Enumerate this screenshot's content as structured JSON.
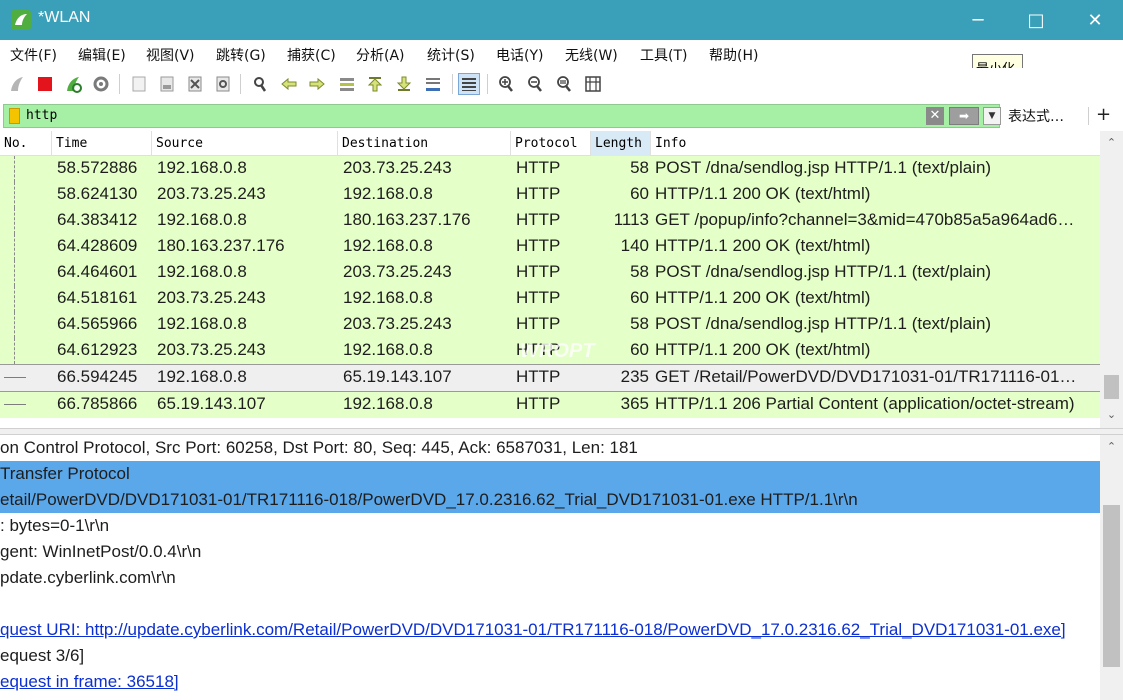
{
  "window": {
    "title": "*WLAN",
    "minimize_glyph": "─",
    "maximize_glyph": "□",
    "close_glyph": "✕",
    "tooltip": "最小化"
  },
  "menu": [
    "文件(F)",
    "编辑(E)",
    "视图(V)",
    "跳转(G)",
    "捕获(C)",
    "分析(A)",
    "统计(S)",
    "电话(Y)",
    "无线(W)",
    "工具(T)",
    "帮助(H)"
  ],
  "toolbar": {
    "icons": [
      "start-capture-icon",
      "stop-capture-icon",
      "restart-capture-icon",
      "capture-options-icon",
      "open-file-icon",
      "save-file-icon",
      "close-file-icon",
      "reload-file-icon",
      "find-packet-icon",
      "go-back-icon",
      "go-forward-icon",
      "go-to-packet-icon",
      "first-packet-icon",
      "last-packet-icon",
      "auto-scroll-icon",
      "colorize-icon",
      "zoom-in-icon",
      "zoom-out-icon",
      "normal-size-icon",
      "resize-columns-icon"
    ]
  },
  "filter": {
    "value": "http",
    "clear_glyph": "✕",
    "apply_glyph": "➡",
    "dropdown_glyph": "▼",
    "expression_label": "表达式…",
    "add_glyph": "+"
  },
  "packet_list": {
    "columns": [
      "No.",
      "Time",
      "Source",
      "Destination",
      "Protocol",
      "Length",
      "Info"
    ],
    "sorted_column": "Length",
    "rows": [
      {
        "time": "58.572886",
        "src": "192.168.0.8",
        "dst": "203.73.25.243",
        "proto": "HTTP",
        "len": "58",
        "info": "POST /dna/sendlog.jsp HTTP/1.1  (text/plain)"
      },
      {
        "time": "58.624130",
        "src": "203.73.25.243",
        "dst": "192.168.0.8",
        "proto": "HTTP",
        "len": "60",
        "info": "HTTP/1.1 200 OK  (text/html)"
      },
      {
        "time": "64.383412",
        "src": "192.168.0.8",
        "dst": "180.163.237.176",
        "proto": "HTTP",
        "len": "1113",
        "info": "GET /popup/info?channel=3&mid=470b85a5a964ad6…"
      },
      {
        "time": "64.428609",
        "src": "180.163.237.176",
        "dst": "192.168.0.8",
        "proto": "HTTP",
        "len": "140",
        "info": "HTTP/1.1 200 OK  (text/html)"
      },
      {
        "time": "64.464601",
        "src": "192.168.0.8",
        "dst": "203.73.25.243",
        "proto": "HTTP",
        "len": "58",
        "info": "POST /dna/sendlog.jsp HTTP/1.1  (text/plain)"
      },
      {
        "time": "64.518161",
        "src": "203.73.25.243",
        "dst": "192.168.0.8",
        "proto": "HTTP",
        "len": "60",
        "info": "HTTP/1.1 200 OK  (text/html)"
      },
      {
        "time": "64.565966",
        "src": "192.168.0.8",
        "dst": "203.73.25.243",
        "proto": "HTTP",
        "len": "58",
        "info": "POST /dna/sendlog.jsp HTTP/1.1  (text/plain)"
      },
      {
        "time": "64.612923",
        "src": "203.73.25.243",
        "dst": "192.168.0.8",
        "proto": "HTTP",
        "len": "60",
        "info": "HTTP/1.1 200 OK  (text/html)"
      },
      {
        "time": "66.594245",
        "src": "192.168.0.8",
        "dst": "65.19.143.107",
        "proto": "HTTP",
        "len": "235",
        "info": "GET /Retail/PowerDVD/DVD171031-01/TR171116-01…"
      },
      {
        "time": "66.785866",
        "src": "65.19.143.107",
        "dst": "192.168.0.8",
        "proto": "HTTP",
        "len": "365",
        "info": "HTTP/1.1 206 Partial Content  (application/octet-stream)"
      }
    ],
    "row_colors": {
      "http": "#e4ffc7",
      "selected": "#efefef"
    },
    "watermark": "WROPT"
  },
  "details": {
    "lines": [
      "on Control Protocol, Src Port: 60258, Dst Port: 80, Seq: 445, Ack: 6587031, Len: 181",
      " Transfer Protocol",
      "etail/PowerDVD/DVD171031-01/TR171116-018/PowerDVD_17.0.2316.62_Trial_DVD171031-01.exe HTTP/1.1\\r\\n",
      ": bytes=0-1\\r\\n",
      "gent: WinInetPost/0.0.4\\r\\n",
      "pdate.cyberlink.com\\r\\n",
      "",
      "quest URI: http://update.cyberlink.com/Retail/PowerDVD/DVD171031-01/TR171116-018/PowerDVD_17.0.2316.62_Trial_DVD171031-01.exe]",
      "equest 3/6]",
      "equest in frame: 36518]"
    ],
    "highlight_color": "#5aa7ea",
    "link_color": "#0b2fd0"
  },
  "scroll": {
    "up_glyph": "⌃",
    "down_glyph": "⌄"
  }
}
